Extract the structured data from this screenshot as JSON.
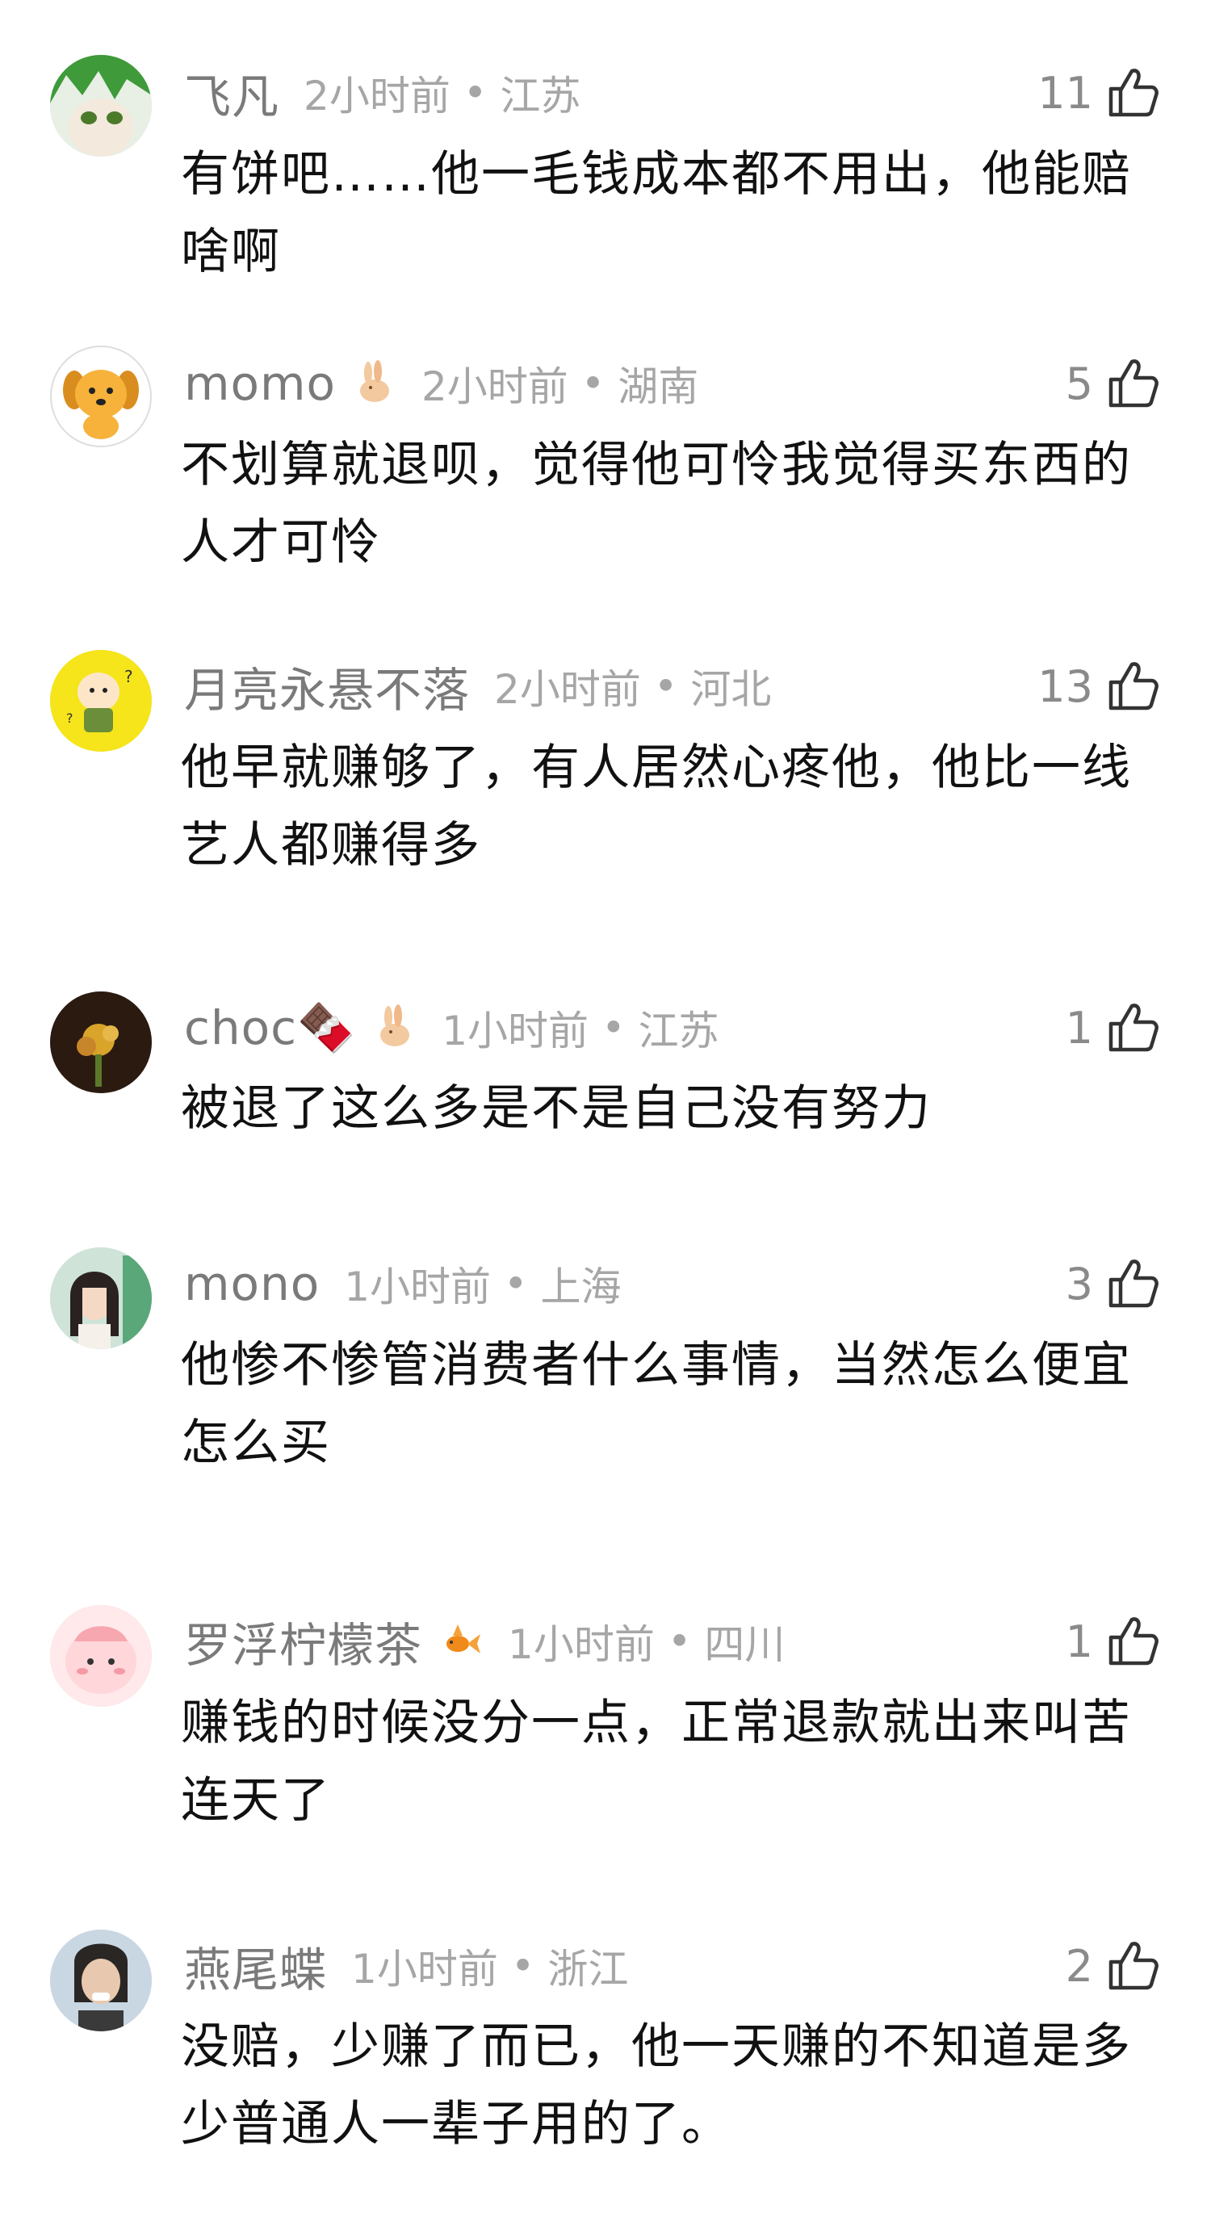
{
  "comments": [
    {
      "username": "飞凡",
      "time": "2小时前",
      "separator": "•",
      "region": "江苏",
      "likes": "11",
      "text": "有饼吧……他一毛钱成本都不用出，他能赔啥啊",
      "badge": ""
    },
    {
      "username": "momo",
      "time": "2小时前",
      "separator": "•",
      "region": "湖南",
      "likes": "5",
      "text": "不划算就退呗，觉得他可怜我觉得买东西的人才可怜",
      "badge": "rabbit-badge-icon"
    },
    {
      "username": "月亮永悬不落",
      "time": "2小时前",
      "separator": "•",
      "region": "河北",
      "likes": "13",
      "text": "他早就赚够了，有人居然心疼他，他比一线艺人都赚得多",
      "badge": ""
    },
    {
      "username": "choc🍫",
      "time": "1小时前",
      "separator": "•",
      "region": "江苏",
      "likes": "1",
      "text": "被退了这么多是不是自己没有努力",
      "badge": "rabbit-badge-icon"
    },
    {
      "username": "mono",
      "time": "1小时前",
      "separator": "•",
      "region": "上海",
      "likes": "3",
      "text": "他惨不惨管消费者什么事情，当然怎么便宜怎么买",
      "badge": ""
    },
    {
      "username": "罗浮柠檬茶",
      "time": "1小时前",
      "separator": "•",
      "region": "四川",
      "likes": "1",
      "text": "赚钱的时候没分一点，正常退款就出来叫苦连天了",
      "badge": "goldfish-badge-icon"
    },
    {
      "username": "燕尾蝶",
      "time": "1小时前",
      "separator": "•",
      "region": "浙江",
      "likes": "2",
      "text": "没赔，少赚了而已，他一天赚的不知道是多少普通人一辈子用的了。",
      "badge": ""
    }
  ]
}
